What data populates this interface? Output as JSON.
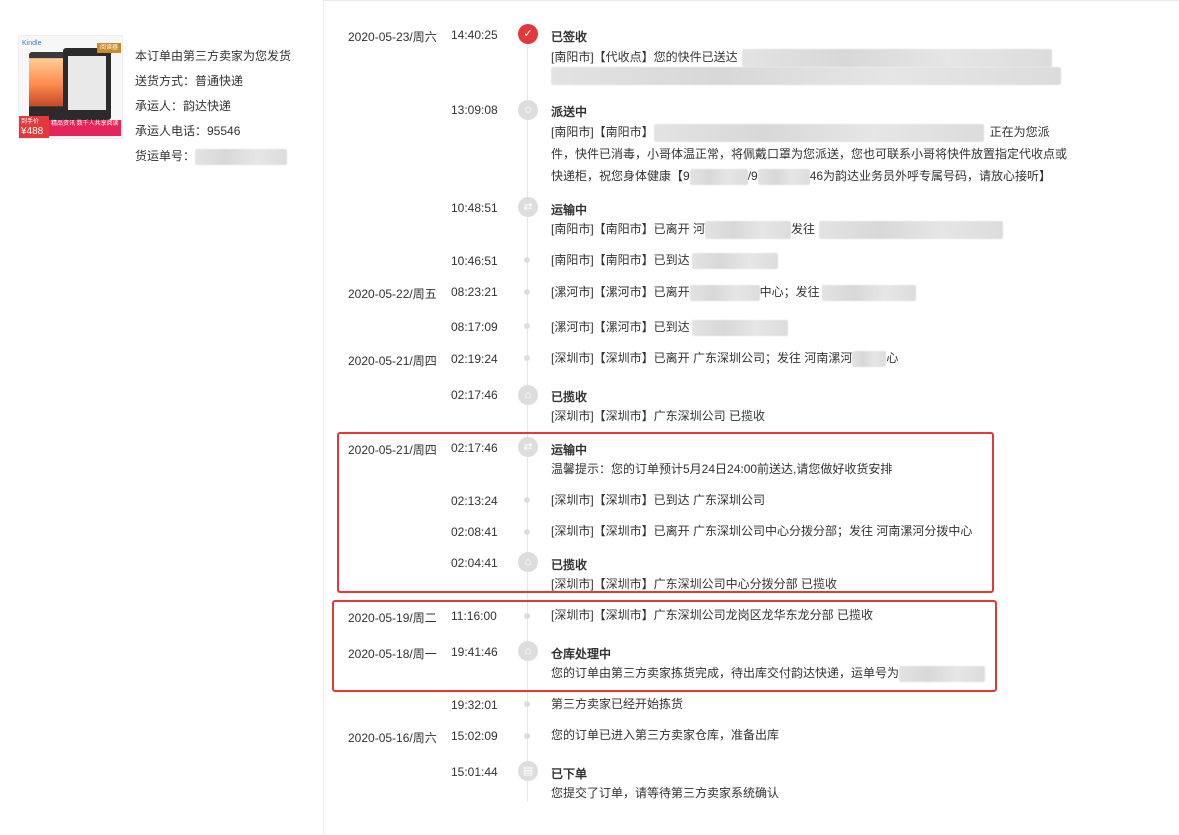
{
  "product": {
    "brand": "Kindle",
    "tag": "阅读器",
    "price_label": "到手价",
    "price": "¥488",
    "banner": "精品资讯 数千人共享阅读"
  },
  "order": {
    "line1": "本订单由第三方卖家为您发货",
    "shipping_method": "送货方式：普通快递",
    "carrier": "承运人：韵达快递",
    "carrier_phone": "承运人电话：95546",
    "tracking_label": "货运单号："
  },
  "events": [
    {
      "date": "2020-05-23/周六",
      "time": "14:40:25",
      "status": "已签收",
      "icon": "check-icon",
      "desc": "[南阳市]【代收点】您的快件已送达"
    },
    {
      "date": "",
      "time": "13:09:08",
      "status": "派送中",
      "icon": "courier-icon",
      "desc_a": "[南阳市]【南阳市】",
      "desc_b": "正在为您派",
      "desc_c": "件，快件已消毒，小哥体温正常，将佩戴口罩为您派送，您也可联系小哥将快件放置指定代收点或",
      "desc_d": "快递柜，祝您身体健康【9",
      "desc_e": "/9",
      "desc_f": "46为韵达业务员外呼专属号码，请放心接听】"
    },
    {
      "date": "",
      "time": "10:48:51",
      "status": "运输中",
      "icon": "truck-icon",
      "desc_a": "[南阳市]【南阳市】已离开 河",
      "desc_b": "发往"
    },
    {
      "date": "",
      "time": "10:46:51",
      "desc": "[南阳市]【南阳市】已到达"
    },
    {
      "date": "2020-05-22/周五",
      "time": "08:23:21",
      "desc_a": "[漯河市]【漯河市】已离开",
      "desc_b": "中心；发往"
    },
    {
      "date": "",
      "time": "08:17:09",
      "desc": "[漯河市]【漯河市】已到达"
    },
    {
      "date": "2020-05-21/周四",
      "time": "02:19:24",
      "desc_a": "[深圳市]【深圳市】已离开 广东深圳公司；发往 河南漯河",
      "desc_b": "心"
    },
    {
      "date": "",
      "time": "02:17:46",
      "status": "已揽收",
      "icon": "pickup-icon",
      "desc": "[深圳市]【深圳市】广东深圳公司 已揽收"
    },
    {
      "date": "2020-05-21/周四",
      "time": "02:17:46",
      "status": "运输中",
      "icon": "truck-icon",
      "desc": "温馨提示：您的订单预计5月24日24:00前送达,请您做好收货安排"
    },
    {
      "date": "",
      "time": "02:13:24",
      "desc": "[深圳市]【深圳市】已到达 广东深圳公司"
    },
    {
      "date": "",
      "time": "02:08:41",
      "desc": "[深圳市]【深圳市】已离开 广东深圳公司中心分拨分部；发往 河南漯河分拨中心"
    },
    {
      "date": "",
      "time": "02:04:41",
      "status": "已揽收",
      "icon": "pickup-icon",
      "desc": "[深圳市]【深圳市】广东深圳公司中心分拨分部 已揽收"
    },
    {
      "date": "2020-05-19/周二",
      "time": "11:16:00",
      "desc": "[深圳市]【深圳市】广东深圳公司龙岗区龙华东龙分部 已揽收"
    },
    {
      "date": "2020-05-18/周一",
      "time": "19:41:46",
      "status": "仓库处理中",
      "icon": "warehouse-icon",
      "desc": "您的订单由第三方卖家拣货完成，待出库交付韵达快递，运单号为"
    },
    {
      "date": "",
      "time": "19:32:01",
      "desc": "第三方卖家已经开始拣货"
    },
    {
      "date": "2020-05-16/周六",
      "time": "15:02:09",
      "desc": "您的订单已进入第三方卖家仓库，准备出库"
    },
    {
      "date": "",
      "time": "15:01:44",
      "status": "已下单",
      "icon": "order-icon",
      "desc": "您提交了订单，请等待第三方卖家系统确认"
    }
  ],
  "colors": {
    "accent": "#e4393c",
    "icon_gray": "#dddddd",
    "line": "#e6e6e6"
  }
}
